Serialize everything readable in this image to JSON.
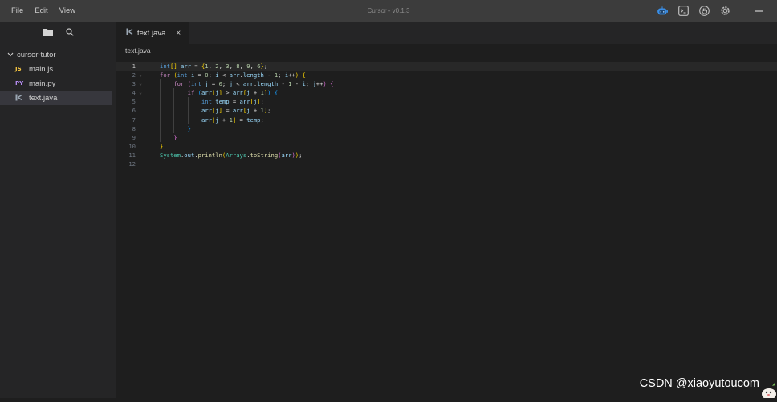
{
  "menu": {
    "file": "File",
    "edit": "Edit",
    "view": "View"
  },
  "app_title": "Cursor - v0.1.3",
  "title_icons": [
    "robot-icon",
    "terminal-icon",
    "hand-icon",
    "settings-gear-icon",
    "minimize-icon"
  ],
  "sidebar": {
    "icons": [
      "folder-icon",
      "search-icon"
    ],
    "folder": "cursor-tutor",
    "items": [
      {
        "badge": "JS",
        "label": "main.js",
        "color": "#f5c542"
      },
      {
        "badge": "PY",
        "label": "main.py",
        "color": "#b58cf0"
      },
      {
        "badge": "",
        "label": "text.java",
        "color": "#9aa6b2",
        "selected": true
      }
    ]
  },
  "tab": {
    "label": "text.java",
    "close": "×"
  },
  "breadcrumb": "text.java",
  "code": {
    "line_numbers": [
      "1",
      "2",
      "3",
      "4",
      "5",
      "6",
      "7",
      "8",
      "9",
      "10",
      "11",
      "12"
    ],
    "lines": [
      "int[] arr = {1, 2, 3, 8, 9, 6};",
      "for (int i = 0; i < arr.length - 1; i++) {",
      "    for (int j = 0; j < arr.length - 1 - i; j++) {",
      "        if (arr[j] > arr[j + 1]) {",
      "            int temp = arr[j];",
      "            arr[j] = arr[j + 1];",
      "            arr[j + 1] = temp;",
      "        }",
      "    }",
      "}",
      "System.out.println(Arrays.toString(arr));",
      ""
    ]
  },
  "colors": {
    "keyword": "#569cd6",
    "control": "#c586c0",
    "variable": "#9cdcfe",
    "number": "#b5cea8",
    "function": "#dcdcaa",
    "class": "#4ec9b0",
    "bracket_gold": "#ffd700",
    "bracket_pink": "#da70d6",
    "bracket_blue": "#179fff"
  },
  "watermark": "CSDN @xiaoyutoucom"
}
